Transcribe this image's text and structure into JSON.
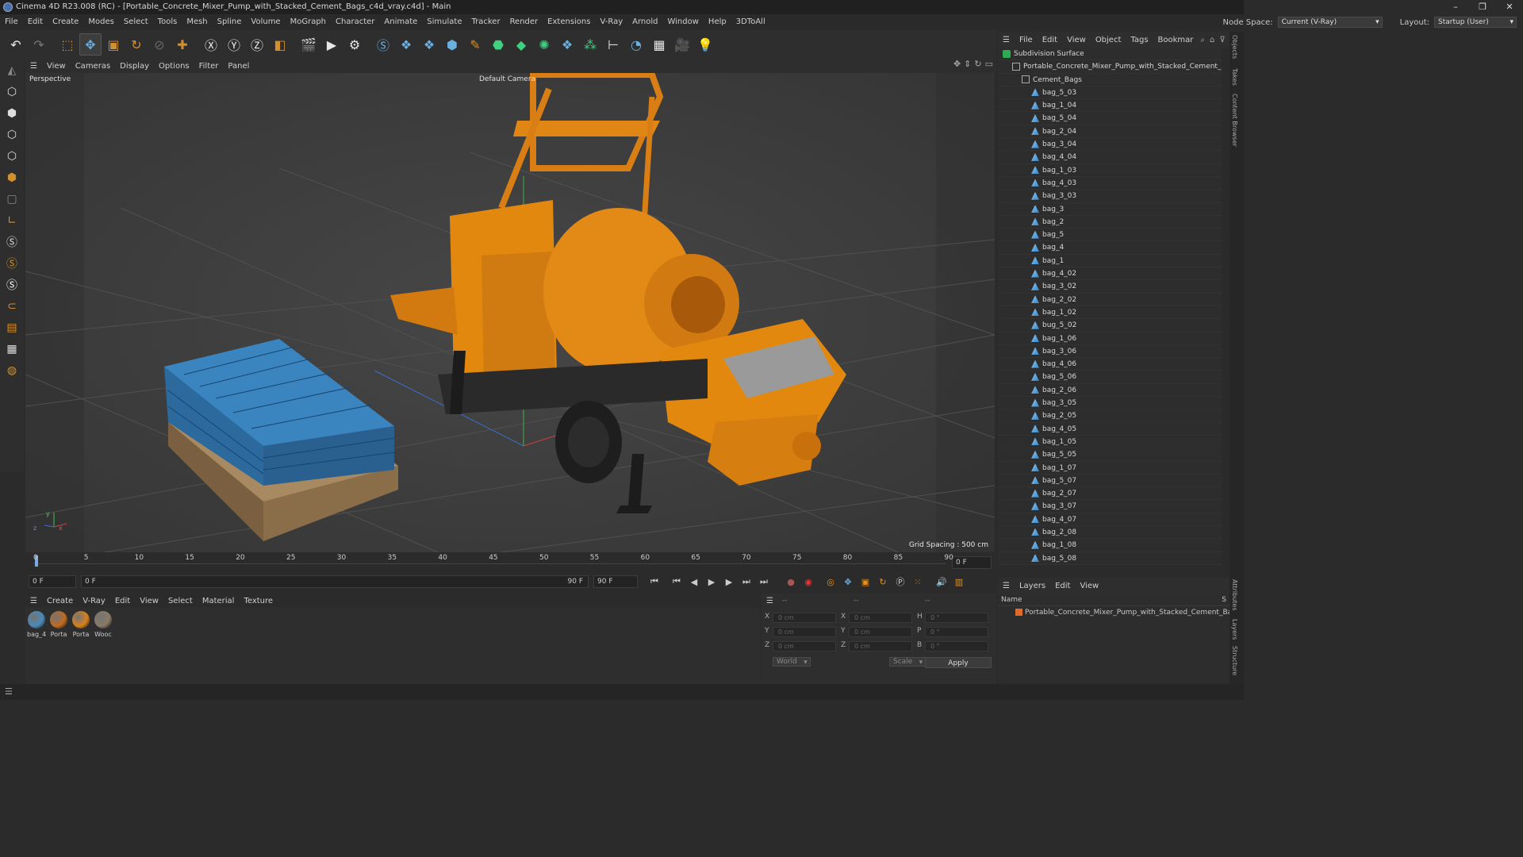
{
  "window": {
    "title": "Cinema 4D R23.008 (RC) - [Portable_Concrete_Mixer_Pump_with_Stacked_Cement_Bags_c4d_vray.c4d] - Main",
    "controls": [
      "–",
      "❐",
      "✕"
    ]
  },
  "menubar": {
    "items": [
      "File",
      "Edit",
      "Create",
      "Modes",
      "Select",
      "Tools",
      "Mesh",
      "Spline",
      "Volume",
      "MoGraph",
      "Character",
      "Animate",
      "Simulate",
      "Tracker",
      "Render",
      "Extensions",
      "V-Ray",
      "Arnold",
      "Window",
      "Help",
      "3DToAll"
    ],
    "node_space_label": "Node Space:",
    "node_space_value": "Current (V-Ray)",
    "layout_label": "Layout:",
    "layout_value": "Startup (User)"
  },
  "viewport": {
    "menu": [
      "View",
      "Cameras",
      "Display",
      "Options",
      "Filter",
      "Panel"
    ],
    "label": "Perspective",
    "camera": "Default Camera",
    "grid_spacing": "Grid Spacing : 500 cm",
    "axis_x": "x",
    "axis_y": "y",
    "axis_z": "z"
  },
  "timeline": {
    "ticks": [
      "0",
      "5",
      "10",
      "15",
      "20",
      "25",
      "30",
      "35",
      "40",
      "45",
      "50",
      "55",
      "60",
      "65",
      "70",
      "75",
      "80",
      "85",
      "90"
    ],
    "current_frame_right": "0 F"
  },
  "playbar": {
    "start_field": "0 F",
    "range_start": "0 F",
    "range_end": "90 F",
    "end_field": "90 F"
  },
  "materials": {
    "menu": [
      "Create",
      "V-Ray",
      "Edit",
      "View",
      "Select",
      "Material",
      "Texture"
    ],
    "items": [
      {
        "name": "bag_4",
        "color": "#4a8ab8"
      },
      {
        "name": "Porta",
        "color": "#c06a20"
      },
      {
        "name": "Porta",
        "color": "#d8801c"
      },
      {
        "name": "Wooc",
        "color": "#8a7a66"
      }
    ]
  },
  "attributes": {
    "header": "--",
    "header2": "--",
    "header3": "--",
    "rows": [
      {
        "a": "X",
        "av": "0 cm",
        "b": "X",
        "bv": "0 cm",
        "c": "H",
        "cv": "0 °"
      },
      {
        "a": "Y",
        "av": "0 cm",
        "b": "Y",
        "bv": "0 cm",
        "c": "P",
        "cv": "0 °"
      },
      {
        "a": "Z",
        "av": "0 cm",
        "b": "Z",
        "bv": "0 cm",
        "c": "B",
        "cv": "0 °"
      }
    ],
    "coord_mode": "World",
    "size_mode": "Scale",
    "apply": "Apply"
  },
  "objects": {
    "menu": [
      "File",
      "Edit",
      "View",
      "Object",
      "Tags",
      "Bookmar"
    ],
    "tree": [
      {
        "name": "Subdivision Surface",
        "level": 0,
        "kind": "subdiv"
      },
      {
        "name": "Portable_Concrete_Mixer_Pump_with_Stacked_Cement_Bags",
        "level": 1,
        "kind": "null"
      },
      {
        "name": "Cement_Bags",
        "level": 2,
        "kind": "null"
      },
      {
        "name": "bag_5_03",
        "level": 3,
        "kind": "mesh"
      },
      {
        "name": "bag_1_04",
        "level": 3,
        "kind": "mesh"
      },
      {
        "name": "bag_5_04",
        "level": 3,
        "kind": "mesh"
      },
      {
        "name": "bag_2_04",
        "level": 3,
        "kind": "mesh"
      },
      {
        "name": "bag_3_04",
        "level": 3,
        "kind": "mesh"
      },
      {
        "name": "bag_4_04",
        "level": 3,
        "kind": "mesh"
      },
      {
        "name": "bag_1_03",
        "level": 3,
        "kind": "mesh"
      },
      {
        "name": "bag_4_03",
        "level": 3,
        "kind": "mesh"
      },
      {
        "name": "bag_3_03",
        "level": 3,
        "kind": "mesh"
      },
      {
        "name": "bag_3",
        "level": 3,
        "kind": "mesh"
      },
      {
        "name": "bag_2",
        "level": 3,
        "kind": "mesh"
      },
      {
        "name": "bag_5",
        "level": 3,
        "kind": "mesh"
      },
      {
        "name": "bag_4",
        "level": 3,
        "kind": "mesh"
      },
      {
        "name": "bag_1",
        "level": 3,
        "kind": "mesh"
      },
      {
        "name": "bag_4_02",
        "level": 3,
        "kind": "mesh"
      },
      {
        "name": "bag_3_02",
        "level": 3,
        "kind": "mesh"
      },
      {
        "name": "bag_2_02",
        "level": 3,
        "kind": "mesh"
      },
      {
        "name": "bag_1_02",
        "level": 3,
        "kind": "mesh"
      },
      {
        "name": "bug_5_02",
        "level": 3,
        "kind": "mesh"
      },
      {
        "name": "bag_1_06",
        "level": 3,
        "kind": "mesh"
      },
      {
        "name": "bag_3_06",
        "level": 3,
        "kind": "mesh"
      },
      {
        "name": "bag_4_06",
        "level": 3,
        "kind": "mesh"
      },
      {
        "name": "bag_5_06",
        "level": 3,
        "kind": "mesh"
      },
      {
        "name": "bag_2_06",
        "level": 3,
        "kind": "mesh"
      },
      {
        "name": "bag_3_05",
        "level": 3,
        "kind": "mesh"
      },
      {
        "name": "bag_2_05",
        "level": 3,
        "kind": "mesh"
      },
      {
        "name": "bag_4_05",
        "level": 3,
        "kind": "mesh"
      },
      {
        "name": "bag_1_05",
        "level": 3,
        "kind": "mesh"
      },
      {
        "name": "bag_5_05",
        "level": 3,
        "kind": "mesh"
      },
      {
        "name": "bag_1_07",
        "level": 3,
        "kind": "mesh"
      },
      {
        "name": "bag_5_07",
        "level": 3,
        "kind": "mesh"
      },
      {
        "name": "bag_2_07",
        "level": 3,
        "kind": "mesh"
      },
      {
        "name": "bag_3_07",
        "level": 3,
        "kind": "mesh"
      },
      {
        "name": "bag_4_07",
        "level": 3,
        "kind": "mesh"
      },
      {
        "name": "bag_2_08",
        "level": 3,
        "kind": "mesh"
      },
      {
        "name": "bag_1_08",
        "level": 3,
        "kind": "mesh"
      },
      {
        "name": "bag_5_08",
        "level": 3,
        "kind": "mesh"
      }
    ]
  },
  "layers": {
    "menu": [
      "Layers",
      "Edit",
      "View"
    ],
    "column": "Name",
    "column_right": "S",
    "items": [
      {
        "name": "Portable_Concrete_Mixer_Pump_with_Stacked_Cement_Bags",
        "color": "#e06a2a"
      }
    ]
  },
  "side_tabs": [
    "Objects",
    "Takes",
    "Content Browser",
    "Attributes",
    "Layers",
    "Structure"
  ],
  "colors": {
    "accent_orange": "#e89018",
    "object_blue": "#6ab0e0"
  }
}
